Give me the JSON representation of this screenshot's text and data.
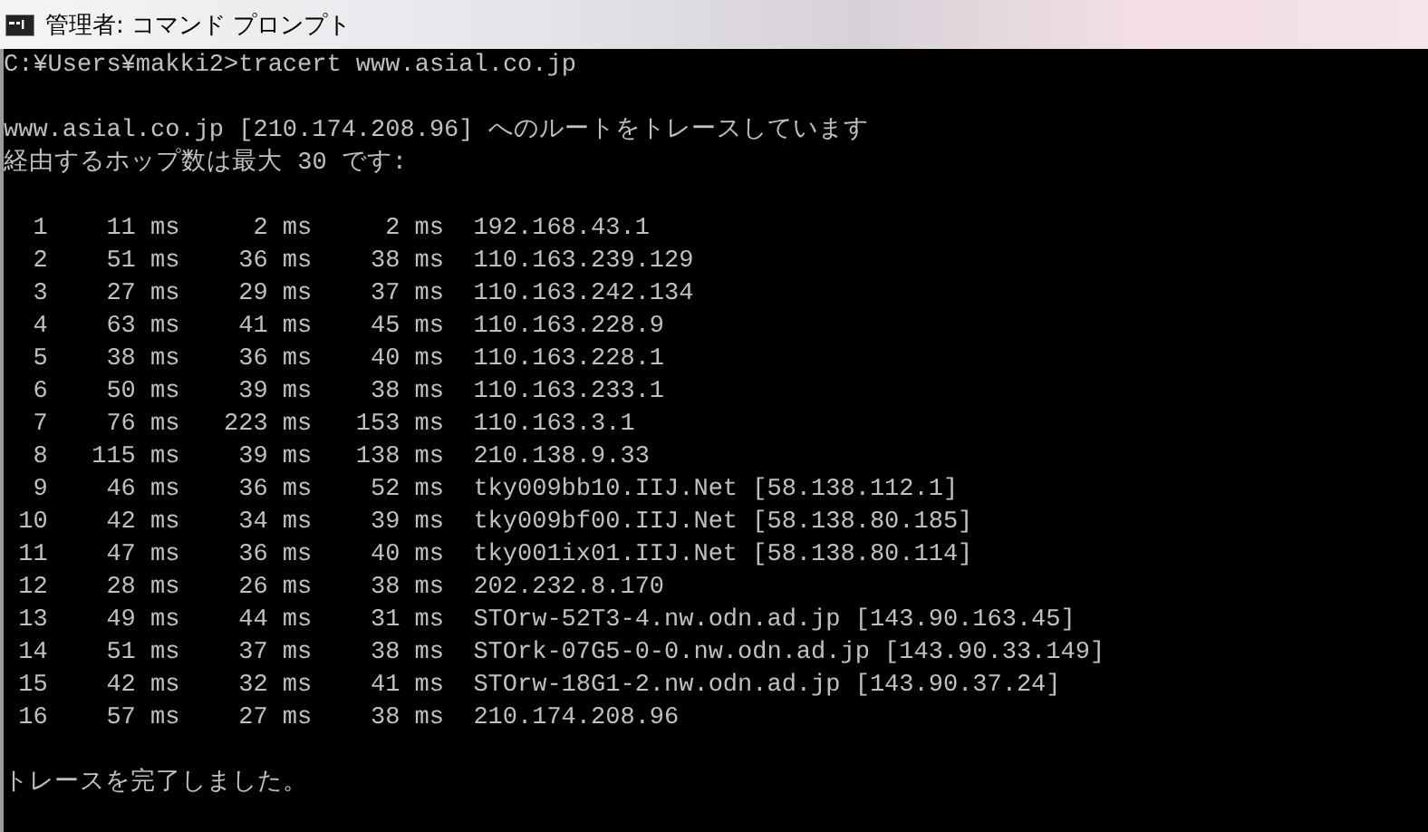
{
  "window": {
    "title": "管理者: コマンド プロンプト"
  },
  "console": {
    "command": "C:¥Users¥makki2>tracert www.asial.co.jp",
    "header": [
      "www.asial.co.jp [210.174.208.96] へのルートをトレースしています",
      "経由するホップ数は最大 30 です:"
    ],
    "hops": [
      {
        "hop": "1",
        "times": [
          "11 ms",
          "2 ms",
          "2 ms"
        ],
        "host": "192.168.43.1"
      },
      {
        "hop": "2",
        "times": [
          "51 ms",
          "36 ms",
          "38 ms"
        ],
        "host": "110.163.239.129"
      },
      {
        "hop": "3",
        "times": [
          "27 ms",
          "29 ms",
          "37 ms"
        ],
        "host": "110.163.242.134"
      },
      {
        "hop": "4",
        "times": [
          "63 ms",
          "41 ms",
          "45 ms"
        ],
        "host": "110.163.228.9"
      },
      {
        "hop": "5",
        "times": [
          "38 ms",
          "36 ms",
          "40 ms"
        ],
        "host": "110.163.228.1"
      },
      {
        "hop": "6",
        "times": [
          "50 ms",
          "39 ms",
          "38 ms"
        ],
        "host": "110.163.233.1"
      },
      {
        "hop": "7",
        "times": [
          "76 ms",
          "223 ms",
          "153 ms"
        ],
        "host": "110.163.3.1"
      },
      {
        "hop": "8",
        "times": [
          "115 ms",
          "39 ms",
          "138 ms"
        ],
        "host": "210.138.9.33"
      },
      {
        "hop": "9",
        "times": [
          "46 ms",
          "36 ms",
          "52 ms"
        ],
        "host": "tky009bb10.IIJ.Net [58.138.112.1]"
      },
      {
        "hop": "10",
        "times": [
          "42 ms",
          "34 ms",
          "39 ms"
        ],
        "host": "tky009bf00.IIJ.Net [58.138.80.185]"
      },
      {
        "hop": "11",
        "times": [
          "47 ms",
          "36 ms",
          "40 ms"
        ],
        "host": "tky001ix01.IIJ.Net [58.138.80.114]"
      },
      {
        "hop": "12",
        "times": [
          "28 ms",
          "26 ms",
          "38 ms"
        ],
        "host": "202.232.8.170"
      },
      {
        "hop": "13",
        "times": [
          "49 ms",
          "44 ms",
          "31 ms"
        ],
        "host": "STOrw-52T3-4.nw.odn.ad.jp [143.90.163.45]"
      },
      {
        "hop": "14",
        "times": [
          "51 ms",
          "37 ms",
          "38 ms"
        ],
        "host": "STOrk-07G5-0-0.nw.odn.ad.jp [143.90.33.149]"
      },
      {
        "hop": "15",
        "times": [
          "42 ms",
          "32 ms",
          "41 ms"
        ],
        "host": "STOrw-18G1-2.nw.odn.ad.jp [143.90.37.24]"
      },
      {
        "hop": "16",
        "times": [
          "57 ms",
          "27 ms",
          "38 ms"
        ],
        "host": "210.174.208.96"
      }
    ],
    "footer": "トレースを完了しました。"
  }
}
